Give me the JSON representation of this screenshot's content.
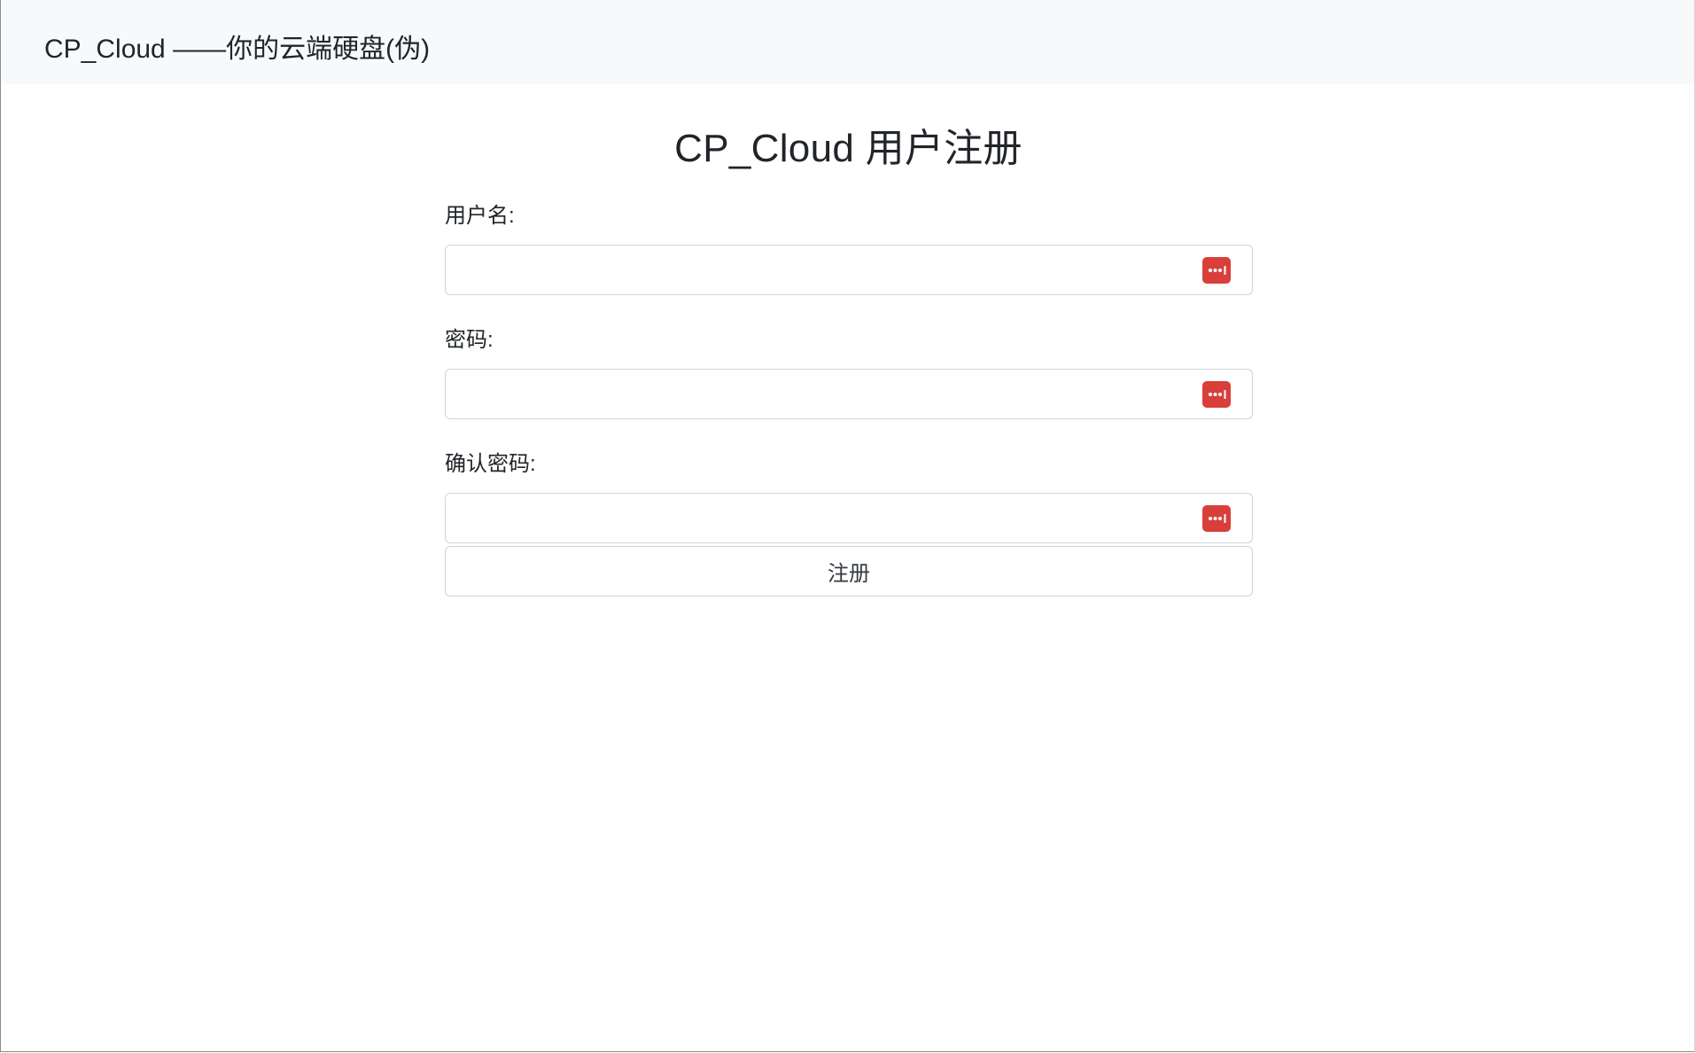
{
  "header": {
    "brand": "CP_Cloud ——你的云端硬盘(伪)"
  },
  "main": {
    "title": "CP_Cloud 用户注册"
  },
  "form": {
    "fields": [
      {
        "label": "用户名:",
        "value": "",
        "icon": "password-manager-icon"
      },
      {
        "label": "密码:",
        "value": "",
        "icon": "password-manager-icon"
      },
      {
        "label": "确认密码:",
        "value": "",
        "icon": "password-manager-icon"
      }
    ],
    "submit_label": "注册"
  },
  "colors": {
    "navbar_bg": "#f8f9fa",
    "text": "#212529",
    "input_border": "#ced4da",
    "icon_red": "#d93f3a"
  }
}
